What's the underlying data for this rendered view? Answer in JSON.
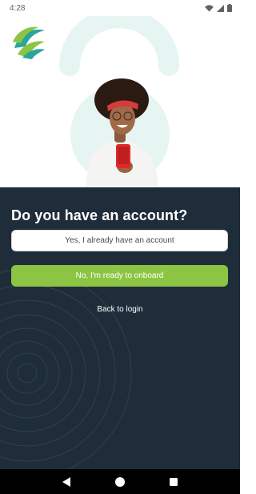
{
  "status_bar": {
    "time": "4:28",
    "icons": [
      "wifi-icon",
      "signal-icon",
      "battery-icon"
    ]
  },
  "hero": {
    "logo_icon": "brand-leaf-logo",
    "colors": {
      "arc": "#e6f5f1",
      "logo_green": "#8cc543",
      "logo_teal": "#2aa59a"
    }
  },
  "panel": {
    "title": "Do you have an account?",
    "existing_account_label": "Yes, I already have an account",
    "onboard_label": "No, I'm ready to onboard",
    "back_label": "Back to login",
    "colors": {
      "background": "#1f2d3a",
      "primary": "#8cc543"
    }
  },
  "nav_bar": {
    "buttons": [
      "back-triangle-icon",
      "home-circle-icon",
      "recents-square-icon"
    ]
  }
}
